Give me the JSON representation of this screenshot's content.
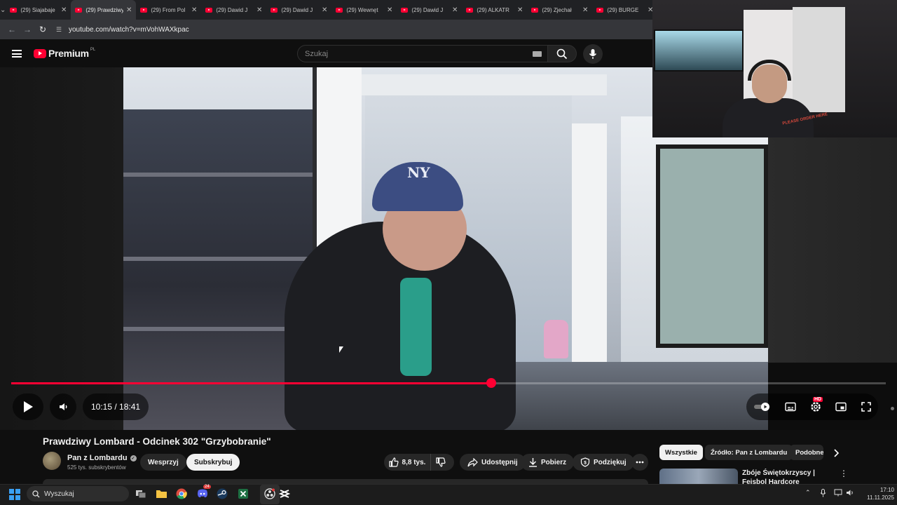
{
  "browser": {
    "tabs": [
      {
        "label": "(29) Siajabaje",
        "active": false
      },
      {
        "label": "(29) Prawdziwy",
        "active": true
      },
      {
        "label": "(29) From Pol",
        "active": false
      },
      {
        "label": "(29) Dawid J",
        "active": false
      },
      {
        "label": "(29) Dawid J",
        "active": false
      },
      {
        "label": "(29) Wewnęt",
        "active": false
      },
      {
        "label": "(29) Dawid J",
        "active": false
      },
      {
        "label": "(29) ALKATR",
        "active": false
      },
      {
        "label": "(29) Zjechał",
        "active": false
      },
      {
        "label": "(29) BURGE",
        "active": false
      }
    ],
    "url": "youtube.com/watch?v=mVohWAXkpac"
  },
  "youtube": {
    "logo_text": "Premium",
    "country_code": "PL",
    "search_placeholder": "Szukaj"
  },
  "player": {
    "time": "10:15 / 18:41",
    "progress_fraction": 0.549,
    "hd_badge": "HD",
    "cap_text": "NY",
    "webcam_shirt_text": "PLEASE ORDER HERE"
  },
  "video_info": {
    "title": "Prawdziwy Lombard - Odcinek 302 \"Grzybobranie\"",
    "channel": "Pan z Lombardu",
    "subscribers": "525 tys. subskrybentów",
    "support_label": "Wesprzyj",
    "subscribe_label": "Subskrybuj",
    "likes": "8,8 tys.",
    "share_label": "Udostępnij",
    "download_label": "Pobierz",
    "thanks_label": "Podziękuj"
  },
  "related": {
    "chips": [
      "Wszystkie",
      "Źródło: Pan z Lombardu",
      "Podobne"
    ],
    "first_title": "Zbóje Świętokrzyscy | Fejsbol Hardcore"
  },
  "taskbar": {
    "search_label": "Wyszukaj",
    "time": "17:10",
    "date": "11.11.2025",
    "discord_badge": "24"
  },
  "colors": {
    "accent": "#ff0033",
    "background": "#0f0f0f",
    "chip_active": "#f1f1f1"
  }
}
